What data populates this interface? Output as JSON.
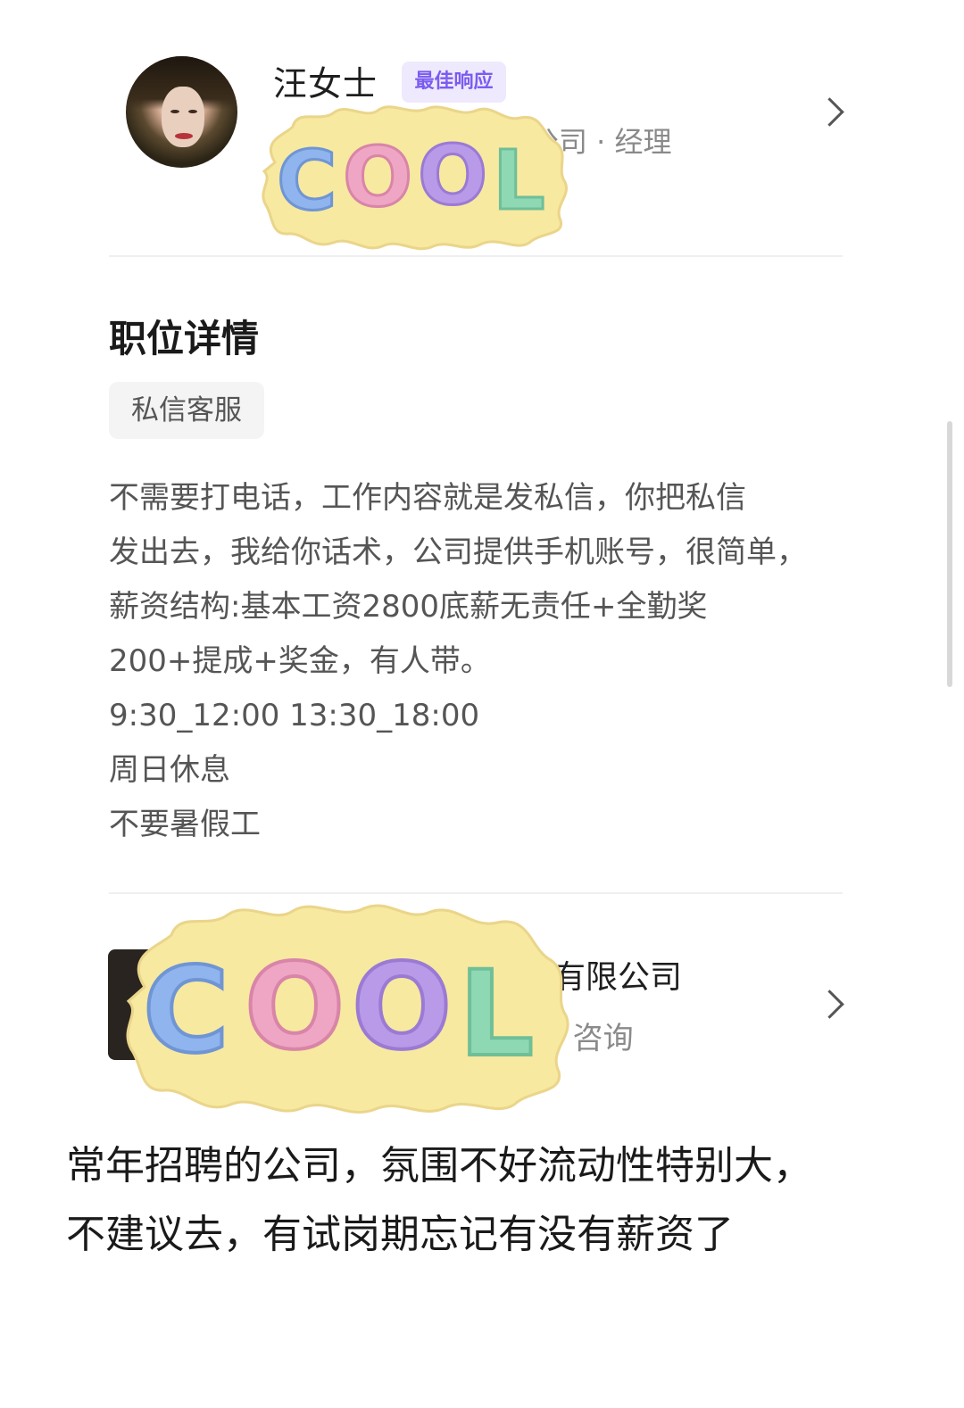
{
  "recruiter": {
    "name": "汪女士",
    "badge": "最佳响应",
    "subtitle_visible": "公司 · 经理",
    "avatar_icon": "recruiter-avatar"
  },
  "job_details": {
    "title": "职位详情",
    "tag": "私信客服",
    "description_lines": [
      "不需要打电话，工作内容就是发私信，你把私信",
      "发出去，我给你话术，公司提供手机账号，很简单，",
      "薪资结构:基本工资2800底薪无责任+全勤奖",
      "200+提成+奖金，有人带。",
      "9:30_12:00 13:30_18:00",
      "周日休息",
      "不要暑假工"
    ]
  },
  "company": {
    "name_visible": "有限公司",
    "subtitle_visible": "· 咨询",
    "logo_icon": "company-logo"
  },
  "caption_lines": [
    "常年招聘的公司，氛围不好流动性特别大，",
    "不建议去，有试岗期忘记有没有薪资了"
  ],
  "stickers": [
    {
      "text": "COOL",
      "letters": [
        "C",
        "O",
        "O",
        "L"
      ]
    },
    {
      "text": "COOL",
      "letters": [
        "C",
        "O",
        "O",
        "L"
      ]
    }
  ],
  "colors": {
    "badge_text": "#7b5cf0",
    "badge_bg": "#efe9fd",
    "sticker_bg": "#f7e9a0",
    "letter_C": "#8fb4ee",
    "letter_O1": "#efa6c4",
    "letter_O2": "#b89ae8",
    "letter_L": "#8fd8b4"
  }
}
